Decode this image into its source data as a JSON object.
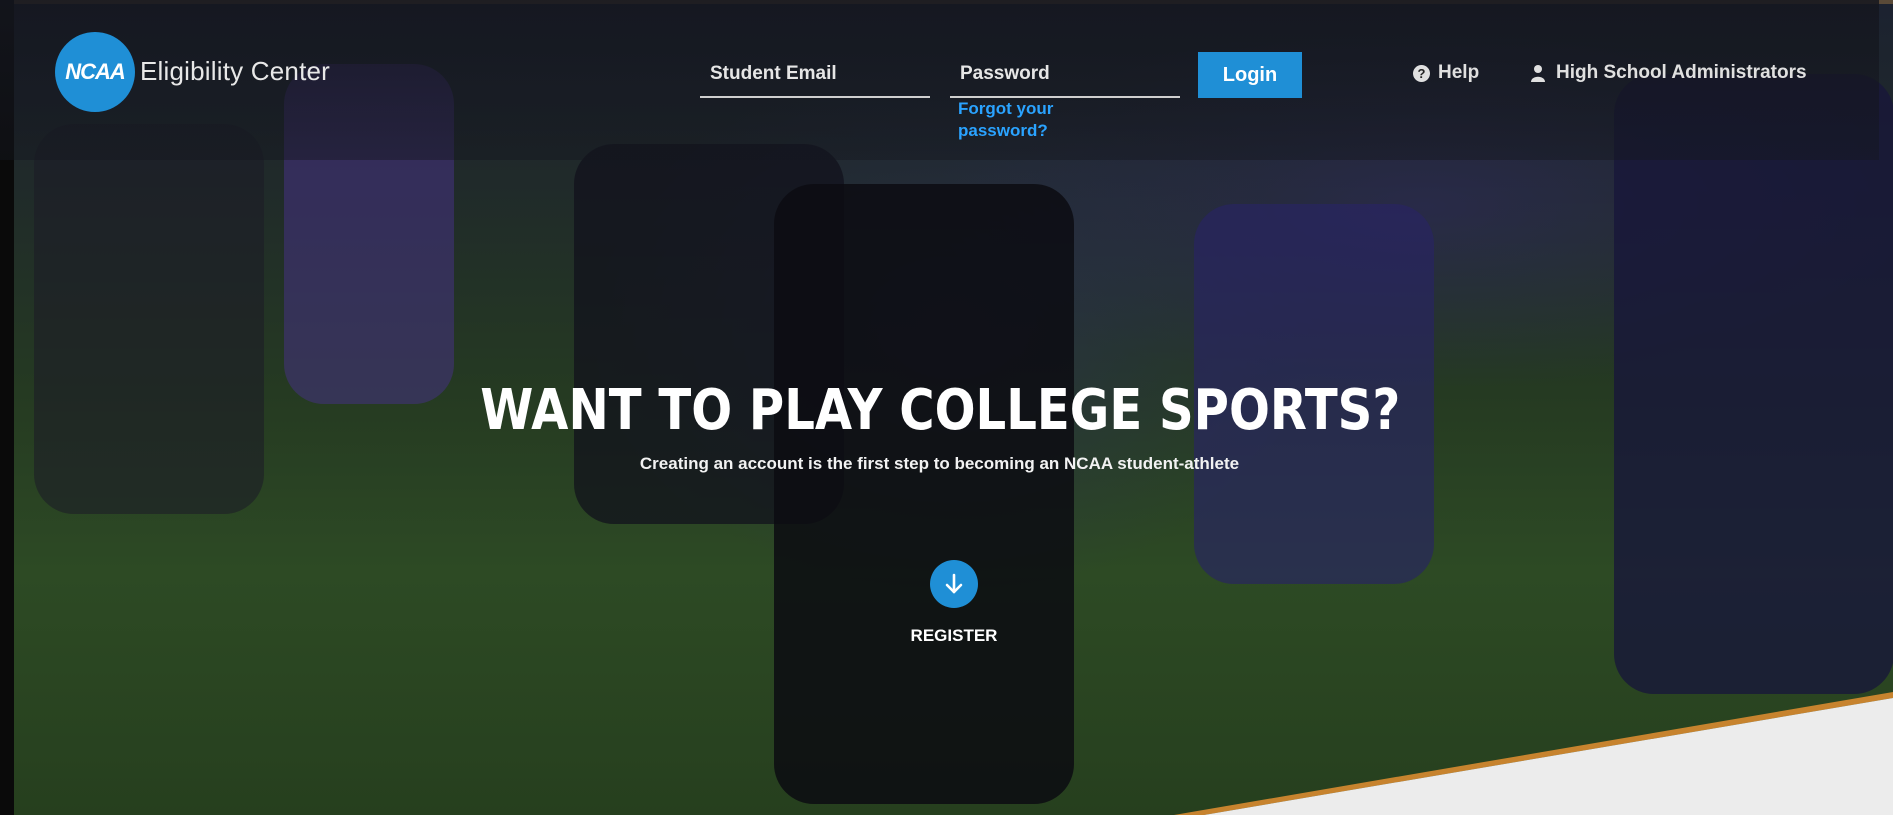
{
  "brand": {
    "logo_text": "NCAA",
    "site_name": "Eligibility Center",
    "accent_color": "#1f8fd6",
    "link_color": "#2aa3ff"
  },
  "login": {
    "email_placeholder": "Student Email",
    "password_placeholder": "Password",
    "forgot_password": "Forgot your password?",
    "login_button": "Login"
  },
  "nav": {
    "help": "Help",
    "help_icon": "question-circle-icon",
    "admins": "High School Administrators",
    "admins_icon": "user-icon"
  },
  "hero": {
    "title": "WANT TO PLAY COLLEGE SPORTS?",
    "subtitle": "Creating an account is the first step to becoming an NCAA student-athlete",
    "register_label": "REGISTER",
    "register_icon": "arrow-down-icon"
  }
}
